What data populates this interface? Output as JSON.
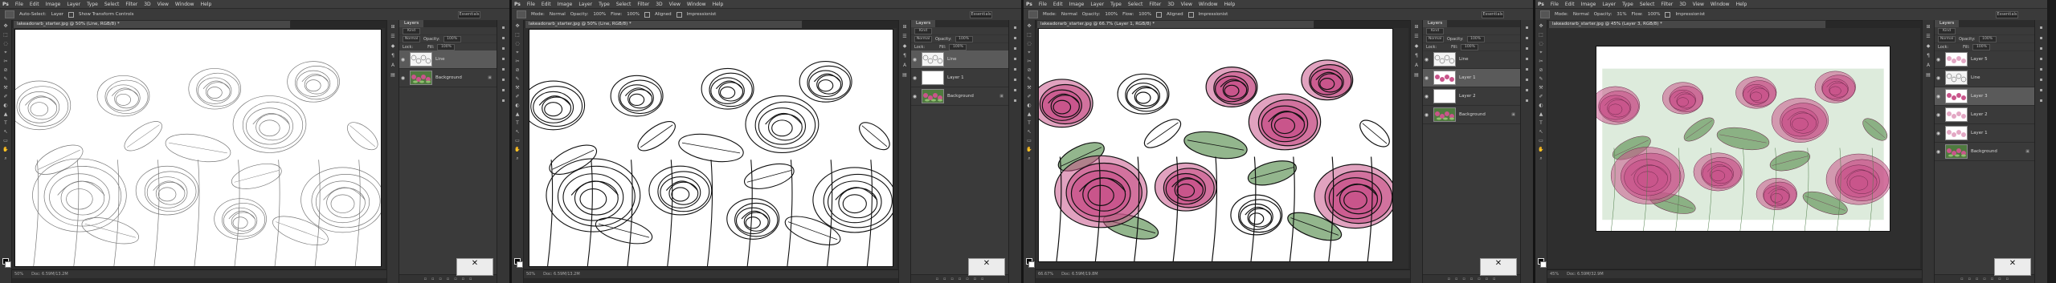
{
  "app": {
    "logo": "Ps",
    "menu": [
      "File",
      "Edit",
      "Image",
      "Layer",
      "Type",
      "Select",
      "Filter",
      "3D",
      "View",
      "Window",
      "Help"
    ]
  },
  "colors": {
    "rose": "#c9558b",
    "leaf": "#6f9e67"
  },
  "windows": [
    {
      "doc_title": "lakeadorarb_starter.jpg @ 50% (Line, RGB/8) *",
      "options": [
        "Auto-Select:",
        "Layer",
        "Show Transform Controls"
      ],
      "workspace": "Essentials",
      "zoom": "50%",
      "doc_size": "Doc: 6.59M/13.2M",
      "panel_tab": "Layers",
      "kind": "Kind",
      "blend_mode": "Normal",
      "opacity_label": "Opacity:",
      "opacity": "100%",
      "lock_label": "Lock:",
      "fill_label": "Fill:",
      "fill": "100%",
      "layers": [
        {
          "name": "Line",
          "thumb": "sketch",
          "selected": true,
          "locked": false
        },
        {
          "name": "Background",
          "thumb": "photo",
          "selected": false,
          "locked": true
        }
      ],
      "canvas": "sketch-faint"
    },
    {
      "doc_title": "lakeadorarb_starter.jpg @ 50% (Line, RGB/8) *",
      "options": [
        "Mode:",
        "Normal",
        "Opacity:",
        "100%",
        "Flow:",
        "100%",
        "Aligned",
        "Impressionist"
      ],
      "workspace": "Essentials",
      "zoom": "50%",
      "doc_size": "Doc: 6.59M/13.2M",
      "panel_tab": "Layers",
      "kind": "Kind",
      "blend_mode": "Normal",
      "opacity_label": "Opacity:",
      "opacity": "100%",
      "lock_label": "Lock:",
      "fill_label": "Fill:",
      "fill": "100%",
      "layers": [
        {
          "name": "Line",
          "thumb": "sketch",
          "selected": true,
          "locked": false
        },
        {
          "name": "Layer 1",
          "thumb": "white",
          "selected": false,
          "locked": false
        },
        {
          "name": "Background",
          "thumb": "photo",
          "selected": false,
          "locked": true
        }
      ],
      "canvas": "sketch-dark"
    },
    {
      "doc_title": "lakeadorarb_starter.jpg @ 66.7% (Layer 1, RGB/8) *",
      "options": [
        "Mode:",
        "Normal",
        "Opacity:",
        "100%",
        "Flow:",
        "100%",
        "Aligned",
        "Impressionist"
      ],
      "workspace": "Essentials",
      "zoom": "66.67%",
      "doc_size": "Doc: 6.59M/19.8M",
      "panel_tab": "Layers",
      "kind": "Kind",
      "blend_mode": "Normal",
      "opacity_label": "Opacity:",
      "opacity": "100%",
      "lock_label": "Lock:",
      "fill_label": "Fill:",
      "fill": "100%",
      "layers": [
        {
          "name": "Line",
          "thumb": "sketch",
          "selected": false,
          "locked": false
        },
        {
          "name": "Layer 1",
          "thumb": "roses",
          "selected": true,
          "locked": false
        },
        {
          "name": "Layer 2",
          "thumb": "white",
          "selected": false,
          "locked": false
        },
        {
          "name": "Background",
          "thumb": "photo",
          "selected": false,
          "locked": true
        }
      ],
      "canvas": "color-partial"
    },
    {
      "doc_title": "lakeadorarb_starter.jpg @ 45% (Layer 3, RGB/8) *",
      "options": [
        "Mode:",
        "Normal",
        "Opacity:",
        "31%",
        "Flow:",
        "100%",
        "Impressionist"
      ],
      "workspace": "Essentials",
      "zoom": "45%",
      "doc_size": "Doc: 6.59M/32.9M",
      "panel_tab": "Layers",
      "kind": "Kind",
      "blend_mode": "Normal",
      "opacity_label": "Opacity:",
      "opacity": "100%",
      "lock_label": "Lock:",
      "fill_label": "Fill:",
      "fill": "100%",
      "layers": [
        {
          "name": "Layer 5",
          "thumb": "roses-light",
          "selected": false,
          "locked": false
        },
        {
          "name": "Line",
          "thumb": "sketch",
          "selected": false,
          "locked": false
        },
        {
          "name": "Layer 3",
          "thumb": "roses",
          "selected": true,
          "locked": false
        },
        {
          "name": "Layer 2",
          "thumb": "roses-light",
          "selected": false,
          "locked": false
        },
        {
          "name": "Layer 1",
          "thumb": "roses-light",
          "selected": false,
          "locked": false
        },
        {
          "name": "Background",
          "thumb": "photo",
          "selected": false,
          "locked": true
        }
      ],
      "canvas": "color-full"
    }
  ]
}
